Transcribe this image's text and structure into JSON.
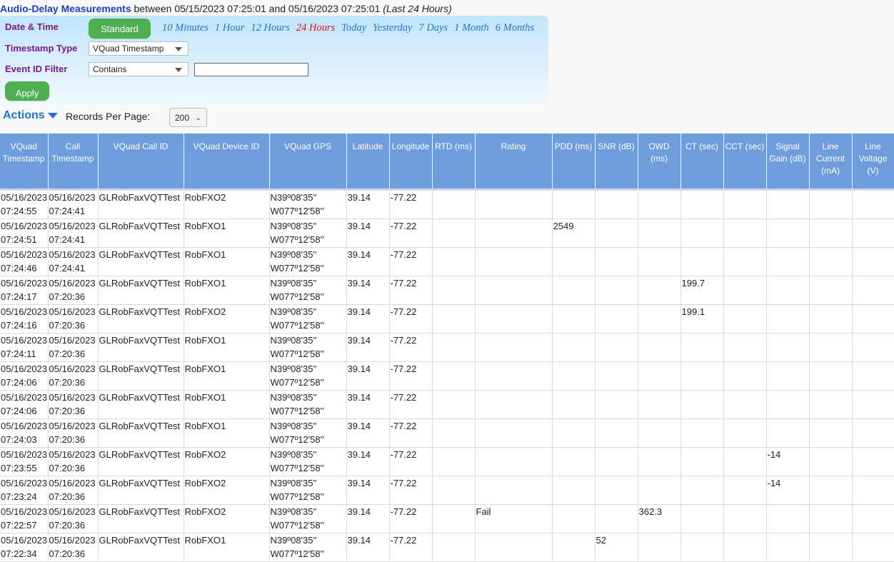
{
  "title": {
    "main": "Audio-Delay Measurements",
    "between": " between 05/15/2023 07:25:01 and 05/16/2023 07:25:01 ",
    "range_label": "(Last 24 Hours)"
  },
  "filters": {
    "date_time_label": "Date & Time",
    "standard_button": "Standard",
    "quick_ranges": [
      "10 Minutes",
      "1 Hour",
      "12 Hours",
      "24 Hours",
      "Today",
      "Yesterday",
      "7 Days",
      "1 Month",
      "6 Months"
    ],
    "active_range": "24 Hours",
    "timestamp_type_label": "Timestamp Type",
    "timestamp_type_value": "VQuad Timestamp",
    "event_id_filter_label": "Event ID Filter",
    "event_id_filter_value": "Contains",
    "event_id_text": "",
    "apply_button": "Apply"
  },
  "toolbar": {
    "actions_label": "Actions",
    "records_per_page_label": "Records Per Page:",
    "records_per_page_value": "200"
  },
  "colors": {
    "header_bg": "#6f9ddc",
    "button_green": "#4caf50",
    "link_blue": "#1f73d6",
    "active_red": "#e8101a",
    "label_purple": "#7a1a8c"
  },
  "table": {
    "columns": [
      "VQuad Timestamp",
      "Call Timestamp",
      "VQuad Call ID",
      "VQuad Device ID",
      "VQuad GPS",
      "Latitude",
      "Longitude",
      "RTD (ms)",
      "Rating",
      "PDD (ms)",
      "SNR (dB)",
      "OWD (ms)",
      "CT (sec)",
      "CCT (sec)",
      "Signal Gain (dB)",
      "Line Current (mA)",
      "Line Voltage (V)"
    ],
    "rows": [
      [
        "05/16/2023 07:24:55",
        "05/16/2023 07:24:41",
        "GLRobFaxVQTTest",
        "RobFXO2",
        "N39º08'35'' W077º12'58''",
        "39.14",
        "-77.22",
        "",
        "",
        "",
        "",
        "",
        "",
        "",
        "",
        "",
        ""
      ],
      [
        "05/16/2023 07:24:51",
        "05/16/2023 07:24:41",
        "GLRobFaxVQTTest",
        "RobFXO1",
        "N39º08'35'' W077º12'58''",
        "39.14",
        "-77.22",
        "",
        "",
        "2549",
        "",
        "",
        "",
        "",
        "",
        "",
        ""
      ],
      [
        "05/16/2023 07:24:46",
        "05/16/2023 07:24:41",
        "GLRobFaxVQTTest",
        "RobFXO1",
        "N39º08'35'' W077º12'58''",
        "39.14",
        "-77.22",
        "",
        "",
        "",
        "",
        "",
        "",
        "",
        "",
        "",
        ""
      ],
      [
        "05/16/2023 07:24:17",
        "05/16/2023 07:20:36",
        "GLRobFaxVQTTest",
        "RobFXO1",
        "N39º08'35'' W077º12'58''",
        "39.14",
        "-77.22",
        "",
        "",
        "",
        "",
        "",
        "199.7",
        "",
        "",
        "",
        ""
      ],
      [
        "05/16/2023 07:24:16",
        "05/16/2023 07:20:36",
        "GLRobFaxVQTTest",
        "RobFXO2",
        "N39º08'35'' W077º12'58''",
        "39.14",
        "-77.22",
        "",
        "",
        "",
        "",
        "",
        "199.1",
        "",
        "",
        "",
        ""
      ],
      [
        "05/16/2023 07:24:11",
        "05/16/2023 07:20:36",
        "GLRobFaxVQTTest",
        "RobFXO1",
        "N39º08'35'' W077º12'58''",
        "39.14",
        "-77.22",
        "",
        "",
        "",
        "",
        "",
        "",
        "",
        "",
        "",
        ""
      ],
      [
        "05/16/2023 07:24:06",
        "05/16/2023 07:20:36",
        "GLRobFaxVQTTest",
        "RobFXO1",
        "N39º08'35'' W077º12'58''",
        "39.14",
        "-77.22",
        "",
        "",
        "",
        "",
        "",
        "",
        "",
        "",
        "",
        ""
      ],
      [
        "05/16/2023 07:24:06",
        "05/16/2023 07:20:36",
        "GLRobFaxVQTTest",
        "RobFXO1",
        "N39º08'35'' W077º12'58''",
        "39.14",
        "-77.22",
        "",
        "",
        "",
        "",
        "",
        "",
        "",
        "",
        "",
        ""
      ],
      [
        "05/16/2023 07:24:03",
        "05/16/2023 07:20:36",
        "GLRobFaxVQTTest",
        "RobFXO1",
        "N39º08'35'' W077º12'58''",
        "39.14",
        "-77.22",
        "",
        "",
        "",
        "",
        "",
        "",
        "",
        "",
        "",
        ""
      ],
      [
        "05/16/2023 07:23:55",
        "05/16/2023 07:20:36",
        "GLRobFaxVQTTest",
        "RobFXO2",
        "N39º08'35'' W077º12'58''",
        "39.14",
        "-77.22",
        "",
        "",
        "",
        "",
        "",
        "",
        "",
        "-14",
        "",
        ""
      ],
      [
        "05/16/2023 07:23:24",
        "05/16/2023 07:20:36",
        "GLRobFaxVQTTest",
        "RobFXO2",
        "N39º08'35'' W077º12'58''",
        "39.14",
        "-77.22",
        "",
        "",
        "",
        "",
        "",
        "",
        "",
        "-14",
        "",
        ""
      ],
      [
        "05/16/2023 07:22:57",
        "05/16/2023 07:20:36",
        "GLRobFaxVQTTest",
        "RobFXO2",
        "N39º08'35'' W077º12'58''",
        "39.14",
        "-77.22",
        "",
        "Fail",
        "",
        "",
        "362.3",
        "",
        "",
        "",
        "",
        ""
      ],
      [
        "05/16/2023 07:22:34",
        "05/16/2023 07:20:36",
        "GLRobFaxVQTTest",
        "RobFXO1",
        "N39º08'35'' W077º12'58''",
        "39.14",
        "-77.22",
        "",
        "",
        "",
        "52",
        "",
        "",
        "",
        "",
        "",
        ""
      ]
    ]
  }
}
